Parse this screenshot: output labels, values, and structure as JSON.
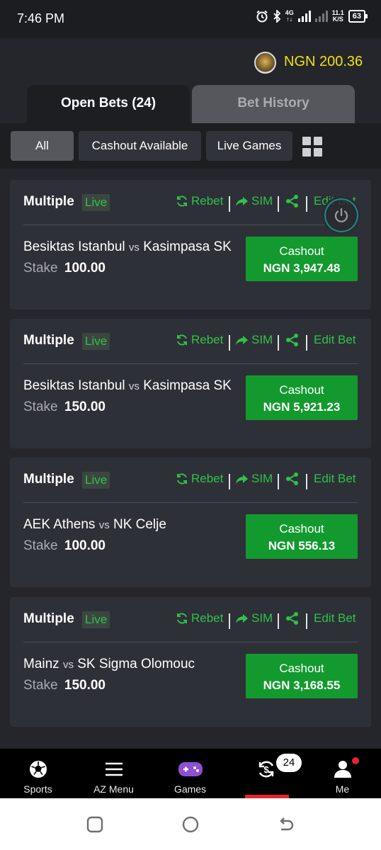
{
  "status_bar": {
    "time": "7:46 PM",
    "network_label": "4G",
    "speed_value": "11.1",
    "speed_unit": "K/S",
    "battery": "63"
  },
  "header": {
    "balance": "NGN 200.36"
  },
  "tabs": [
    {
      "label": "Open Bets (24)",
      "active": true
    },
    {
      "label": "Bet History",
      "active": false
    }
  ],
  "filters": [
    {
      "label": "All",
      "active": true
    },
    {
      "label": "Cashout Available",
      "active": false
    },
    {
      "label": "Live Games",
      "active": false
    }
  ],
  "actions": {
    "rebet": "Rebet",
    "sim": "SIM",
    "edit": "Edit Bet"
  },
  "bets": [
    {
      "type": "Multiple",
      "badge": "Live",
      "home": "Besiktas Istanbul",
      "vs": "vs",
      "away": "Kasimpasa SK",
      "stake_label": "Stake",
      "stake": "100.00",
      "cashout_label": "Cashout",
      "cashout_amount": "NGN 3,947.48"
    },
    {
      "type": "Multiple",
      "badge": "Live",
      "home": "Besiktas Istanbul",
      "vs": "vs",
      "away": "Kasimpasa SK",
      "stake_label": "Stake",
      "stake": "150.00",
      "cashout_label": "Cashout",
      "cashout_amount": "NGN 5,921.23"
    },
    {
      "type": "Multiple",
      "badge": "Live",
      "home": "AEK Athens",
      "vs": "vs",
      "away": "NK Celje",
      "stake_label": "Stake",
      "stake": "100.00",
      "cashout_label": "Cashout",
      "cashout_amount": "NGN 556.13"
    },
    {
      "type": "Multiple",
      "badge": "Live",
      "home": "Mainz",
      "vs": "vs",
      "away": "SK Sigma Olomouc",
      "stake_label": "Stake",
      "stake": "150.00",
      "cashout_label": "Cashout",
      "cashout_amount": "NGN 3,168.55"
    }
  ],
  "bottom_nav": {
    "items": [
      {
        "label": "Sports",
        "icon": "soccer-ball-icon"
      },
      {
        "label": "AZ Menu",
        "icon": "menu-icon"
      },
      {
        "label": "Games",
        "icon": "gamepad-icon"
      },
      {
        "label": "",
        "icon": "cashout-icon",
        "badge": "24"
      },
      {
        "label": "Me",
        "icon": "user-icon"
      }
    ]
  },
  "colors": {
    "accent_green": "#2fc24a",
    "cashout_green": "#139a2e",
    "balance_yellow": "#f1e10f",
    "active_red": "#e3262a"
  }
}
